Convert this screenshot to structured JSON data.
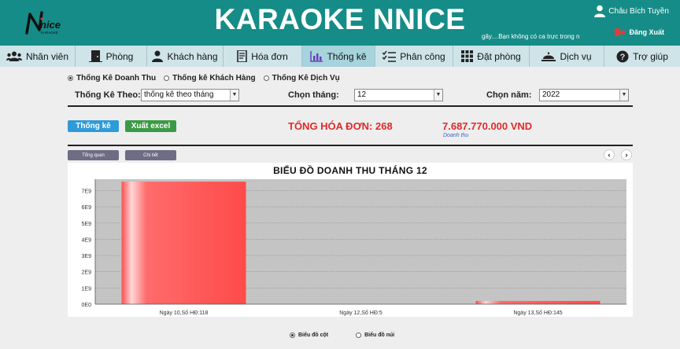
{
  "header": {
    "logo_text": "Nnice",
    "logo_sub": "KARAOKE",
    "title": "KARAOKE NNICE",
    "user_name": "Châu Bích Tuyền",
    "marquee": "gây....Bạn không có ca trực trong n",
    "logout_label": "Đăng Xuất"
  },
  "nav": {
    "items": [
      {
        "label": "Nhân viên",
        "icon": "users-icon"
      },
      {
        "label": "Phòng",
        "icon": "door-icon"
      },
      {
        "label": "Khách hàng",
        "icon": "customer-icon"
      },
      {
        "label": "Hóa đơn",
        "icon": "invoice-icon"
      },
      {
        "label": "Thống kê",
        "icon": "bar-chart-icon"
      },
      {
        "label": "Phân công",
        "icon": "checklist-icon"
      },
      {
        "label": "Đặt phòng",
        "icon": "grid-icon"
      },
      {
        "label": "Dịch vụ",
        "icon": "service-bell-icon"
      },
      {
        "label": "Trợ giúp",
        "icon": "help-icon"
      }
    ],
    "active_index": 4
  },
  "report_types": [
    {
      "label": "Thống Kê Doanh Thu",
      "selected": true
    },
    {
      "label": "Thống kê Khách Hàng",
      "selected": false
    },
    {
      "label": "Thống Kê Dịch Vụ",
      "selected": false
    }
  ],
  "filters": {
    "by_label": "Thống Kê Theo:",
    "by_value": "thống kê theo tháng",
    "month_label": "Chọn tháng:",
    "month_value": "12",
    "year_label": "Chọn năm:",
    "year_value": "2022"
  },
  "actions": {
    "stats_button": "Thống kê",
    "excel_button": "Xuất excel"
  },
  "summary": {
    "total_bills": "TỔNG HÓA ĐƠN: 268",
    "revenue": "7.687.770.000 VND",
    "revenue_caption": "Doanh thu"
  },
  "view_tabs": {
    "overview": "Tổng quan",
    "detail": "Chi tiết",
    "prev": "‹",
    "next": "›"
  },
  "chart_types": [
    {
      "label": "Biểu đồ cột",
      "selected": true
    },
    {
      "label": "Biểu đồ núi",
      "selected": false
    }
  ],
  "colors": {
    "header_bg": "#158c87",
    "accent_red": "#e02a2a",
    "bar": "#ff5a5a"
  },
  "chart_data": {
    "type": "bar",
    "title": "BIỂU ĐỒ DOANH THU THÁNG 12",
    "categories": [
      "Ngày 10,Số HĐ:118",
      "Ngày 12,Số HĐ:5",
      "Ngày 13,Số HĐ:145"
    ],
    "values": [
      7550000000,
      0,
      200000000
    ],
    "yticks": [
      "0E0",
      "1E9",
      "2E9",
      "3E9",
      "4E9",
      "5E9",
      "6E9",
      "7E9"
    ],
    "ylim": [
      0,
      7700000000
    ],
    "grid": true
  }
}
